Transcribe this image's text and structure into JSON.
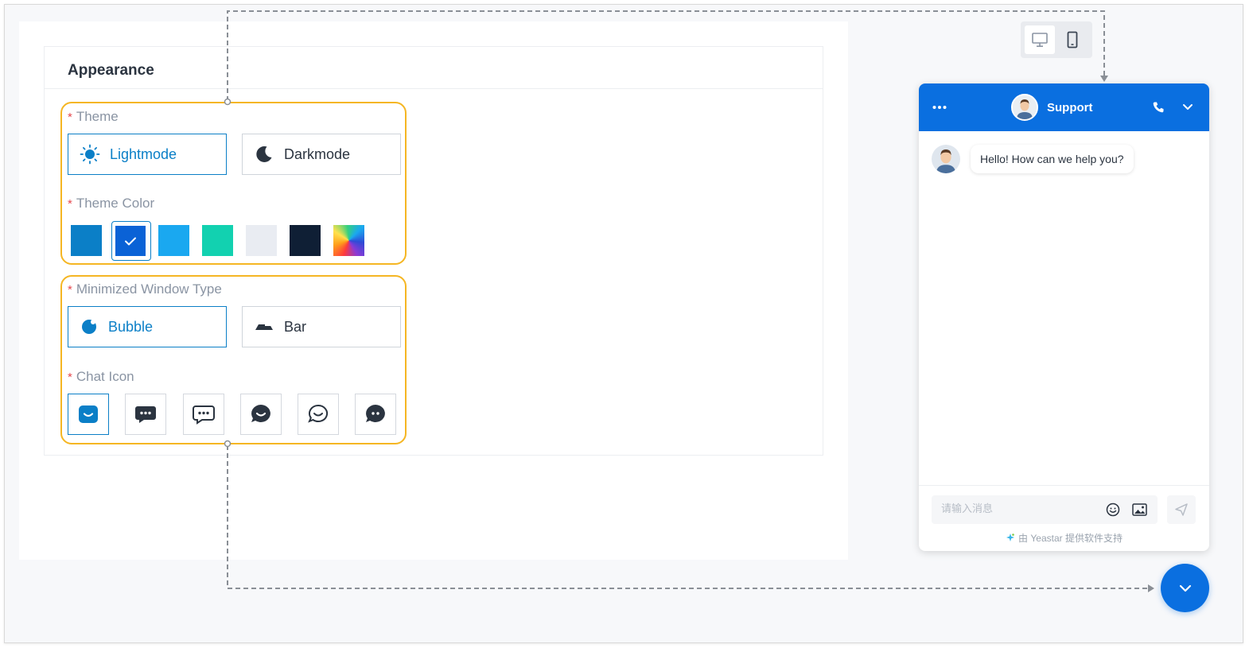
{
  "appearance": {
    "title": "Appearance",
    "theme": {
      "label": "Theme",
      "options": [
        {
          "label": "Lightmode",
          "icon": "sun-icon",
          "selected": true
        },
        {
          "label": "Darkmode",
          "icon": "moon-icon",
          "selected": false
        }
      ]
    },
    "theme_color": {
      "label": "Theme Color",
      "swatches": [
        {
          "color": "#0b7fc7",
          "selected": false
        },
        {
          "color": "#0a62d6",
          "selected": true
        },
        {
          "color": "#1aa8f0",
          "selected": false
        },
        {
          "color": "#12d1b0",
          "selected": false
        },
        {
          "color": "#e9ecf2",
          "selected": false
        },
        {
          "color": "#0f1f35",
          "selected": false
        },
        {
          "color": "gradient",
          "selected": false
        }
      ]
    },
    "minimized_window_type": {
      "label": "Minimized Window Type",
      "options": [
        {
          "label": "Bubble",
          "icon": "bubble-icon",
          "selected": true
        },
        {
          "label": "Bar",
          "icon": "bar-icon",
          "selected": false
        }
      ]
    },
    "chat_icon": {
      "label": "Chat Icon",
      "icons": [
        "smile-square-icon",
        "dots-square-icon",
        "dots-outline-square-icon",
        "smile-bubble-icon",
        "smile-bubble-outline-icon",
        "dots-bubble-icon"
      ]
    },
    "required_mark": "*"
  },
  "preview": {
    "devices": [
      "desktop-icon",
      "mobile-icon"
    ],
    "widget": {
      "title": "Support",
      "greeting": "Hello! How can we help you?",
      "input_placeholder": "请输入消息",
      "powered_by": "由 Yeastar 提供软件支持"
    }
  },
  "colors": {
    "accent": "#0b7fc7",
    "widget_blue": "#0a6fe0",
    "highlight": "#f5b623",
    "required": "#e5484d"
  }
}
